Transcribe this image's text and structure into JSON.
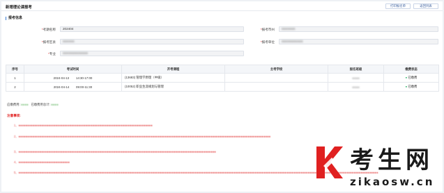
{
  "page": {
    "title": "新增理论课报考"
  },
  "toolbar": {
    "print_label": "打印报名单",
    "back_label": "返回列表"
  },
  "section": {
    "title": "报考信息"
  },
  "form": {
    "exam_name": {
      "label": "考期名称",
      "value": "202404"
    },
    "exam_city": {
      "label": "报考市州",
      "value": "●●●●●●●"
    },
    "exam_district": {
      "label": "报考区县",
      "value": "●●●●●●"
    },
    "exam_unit": {
      "label": "报考单位",
      "value": "●●●●●●●●●●●"
    },
    "major": {
      "label": "专业",
      "value": "●●●●●●●●●●●●●"
    }
  },
  "table": {
    "headers": [
      "序号",
      "考试时间",
      "开考课程",
      "主考学校",
      "报名班级",
      "缴费状态"
    ],
    "rows": [
      {
        "index": "1",
        "date": "2024-04-13",
        "time": "14:30-17:00",
        "course": "(13683) 管理学原理（中级）",
        "school": "",
        "class": "●●●●",
        "status": "已缴费"
      },
      {
        "index": "2",
        "date": "2024-04-14",
        "time": "09:00-11:30",
        "course": "(10052) 职业生涯规划与管理",
        "school": "",
        "class": "●●●●",
        "status": "已缴费"
      }
    ]
  },
  "fees": {
    "label_total": "应缴费用:",
    "total_value": "●●●●",
    "label_paid": "已缴费用总计:",
    "paid_value": "●●●●"
  },
  "notice": {
    "title": "注意事项:",
    "items": [
      "1、●●●●●●●●●●●●●●●●●●●●●●●●●●●●●●●●●●●●●●●●●●●●●●●●●●●●●●●●●●●●●●●●●●●●●●●●●●●●",
      "2、●●●●●●●●●●●●●●●●●●●●●●●●●●●●●●●●●●●●●●●●●●●●●●●●●●●●●●●●●●●●●●●●●●●●●●●●●●●●●●●●●●●●●●●●●●●●●●●●●●●●●●●●●●●●●●●●●●●●●●●●●●●●●●●●●●●●●●●●●●●●●●●",
      "3、●●●●●●●●●●●●●●●●●●●●●●●●●●●●●●●●●●●●●●●●●●●●●●●●●●●●●●●●●●●●●●●●●●●●●●●●●●●●●●●●●●●●●●●●●●●●●●●●●●●●●●●●●●●●●●●●",
      "4、●●●●●●●●●●●●●●●●●●●●●●●●●●●●●",
      "5、●●●●●●●●●●●●●●●●●●●●●●●●●●●●●●●●●●●●●●●●●●●●●●●●●●●●●●●●●●●●●●●●●●●●●●●●●●●●●●●●●●●●●●●●●●●●●●●●●●●●●●●●●●●●●●●●●●●●●●●●●●●●●●●●●●●●●●●●●●●●●●●●●●●●●●●●●●●●●●●●●●●●●●●●●●●●●●●●●●●●●●●●●●●●●●●●●●●●●●●●●●●●"
    ]
  },
  "watermark": {
    "brand": "考生网",
    "url": "zikaosw.cn",
    "accent_color": "#e02020"
  },
  "colors": {
    "accent": "#3a7bd5",
    "required": "#e02020",
    "paid": "#1aad5c",
    "notice": "#e34545"
  }
}
